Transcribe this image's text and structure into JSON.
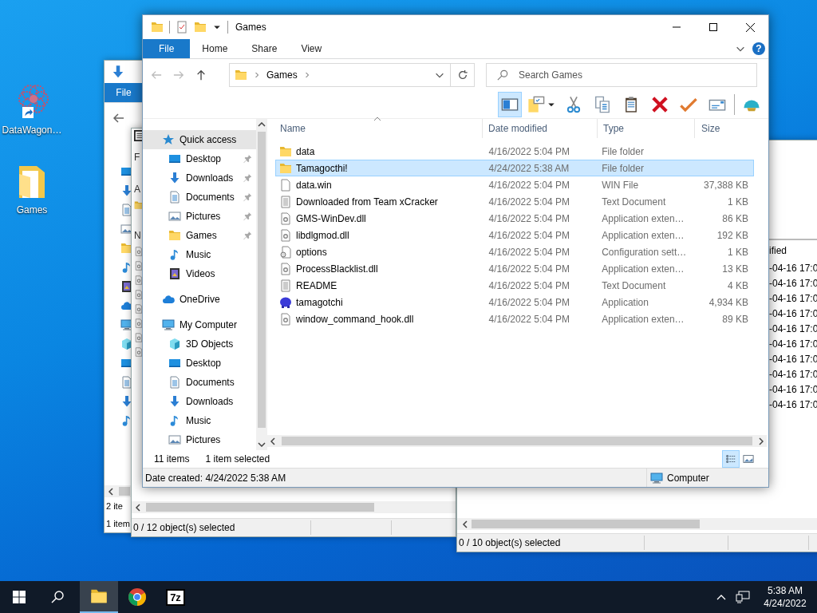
{
  "desktop_icons": [
    {
      "label": "DataWagon…",
      "kind": "app",
      "shortcut": true
    },
    {
      "label": "Games",
      "kind": "folder",
      "shortcut": false
    }
  ],
  "background_windows": [
    {
      "kind": "explorer",
      "ribbon_tab": "File",
      "nav_icons": [
        {
          "kind": "desktop"
        },
        {
          "kind": "download"
        },
        {
          "kind": "documents"
        },
        {
          "kind": "pictures"
        },
        {
          "kind": "folder"
        },
        {
          "kind": "music"
        },
        {
          "kind": "videos"
        },
        {
          "kind": "cloud"
        },
        {
          "kind": "computer"
        },
        {
          "kind": "cube"
        },
        {
          "kind": "desktop"
        },
        {
          "kind": "documents"
        },
        {
          "kind": "download"
        },
        {
          "kind": "music"
        }
      ],
      "status_lines": [
        "2 ite",
        "1 item"
      ]
    },
    {
      "kind": "archiver-left",
      "side_labels": [
        "F",
        "A",
        "N"
      ],
      "status": "0 / 12 object(s) selected"
    },
    {
      "kind": "archiver-right",
      "column_header": "ified",
      "cells": [
        "-04-16 17:0",
        "-04-16 17:0",
        "-04-16 17:0",
        "-04-16 17:0",
        "-04-16 17:0",
        "-04-16 17:0",
        "-04-16 17:0",
        "-04-16 17:0",
        "-04-16 17:0",
        "-04-16 17:0"
      ],
      "status": "0 / 10 object(s) selected"
    }
  ],
  "window": {
    "title": "Games",
    "ribbon_tabs": [
      {
        "label": "File",
        "selected": true
      },
      {
        "label": "Home",
        "selected": false
      },
      {
        "label": "Share",
        "selected": false
      },
      {
        "label": "View",
        "selected": false
      }
    ],
    "help_label": "?",
    "address": {
      "path": [
        "Games"
      ]
    },
    "search": {
      "placeholder": "Search Games"
    },
    "toolbar": [
      {
        "kind": "preview-pane",
        "selected": true
      },
      {
        "kind": "new-folder",
        "selected": false
      },
      {
        "kind": "cut",
        "selected": false
      },
      {
        "kind": "copy",
        "selected": false
      },
      {
        "kind": "paste",
        "selected": false
      },
      {
        "kind": "delete",
        "selected": false
      },
      {
        "kind": "check",
        "selected": false
      },
      {
        "kind": "envelope",
        "selected": false
      },
      {
        "kind": "shell",
        "selected": false
      }
    ],
    "navigation": [
      {
        "label": "Quick access",
        "kind": "star",
        "selected": true,
        "children": [
          {
            "label": "Desktop",
            "kind": "desktop",
            "pinned": true,
            "selected": false
          },
          {
            "label": "Downloads",
            "kind": "download",
            "pinned": true,
            "selected": false
          },
          {
            "label": "Documents",
            "kind": "documents",
            "pinned": true,
            "selected": false
          },
          {
            "label": "Pictures",
            "kind": "pictures",
            "pinned": true,
            "selected": false
          },
          {
            "label": "Games",
            "kind": "folder",
            "pinned": true,
            "selected": false
          },
          {
            "label": "Music",
            "kind": "music",
            "pinned": false,
            "selected": false
          },
          {
            "label": "Videos",
            "kind": "videos",
            "pinned": false,
            "selected": false
          }
        ]
      },
      {
        "label": "OneDrive",
        "kind": "cloud",
        "selected": false
      },
      {
        "label": "My Computer",
        "kind": "computer",
        "selected": false,
        "children": [
          {
            "label": "3D Objects",
            "kind": "cube",
            "pinned": false,
            "selected": false
          },
          {
            "label": "Desktop",
            "kind": "desktop",
            "pinned": false,
            "selected": false
          },
          {
            "label": "Documents",
            "kind": "documents",
            "pinned": false,
            "selected": false
          },
          {
            "label": "Downloads",
            "kind": "download",
            "pinned": false,
            "selected": false
          },
          {
            "label": "Music",
            "kind": "music",
            "pinned": false,
            "selected": false
          },
          {
            "label": "Pictures",
            "kind": "pictures",
            "pinned": false,
            "selected": false
          }
        ]
      }
    ],
    "columns": [
      {
        "label": "Name",
        "sorted": true
      },
      {
        "label": "Date modified",
        "sorted": false
      },
      {
        "label": "Type",
        "sorted": false
      },
      {
        "label": "Size",
        "sorted": false
      }
    ],
    "files": [
      {
        "name": "data",
        "date": "4/16/2022 5:04 PM",
        "type": "File folder",
        "kind": "folder",
        "selected": false
      },
      {
        "name": "Tamagocthi!",
        "date": "4/24/2022 5:38 AM",
        "type": "File folder",
        "kind": "folder",
        "selected": true
      },
      {
        "name": "data.win",
        "date": "4/16/2022 5:04 PM",
        "type": "WIN File",
        "size": "37,388 KB",
        "kind": "file",
        "selected": false
      },
      {
        "name": "Downloaded from Team xCracker",
        "date": "4/16/2022 5:04 PM",
        "type": "Text Document",
        "size": "1 KB",
        "kind": "text",
        "selected": false
      },
      {
        "name": "GMS-WinDev.dll",
        "date": "4/16/2022 5:04 PM",
        "type": "Application exten…",
        "size": "86 KB",
        "kind": "dll",
        "selected": false
      },
      {
        "name": "libdlgmod.dll",
        "date": "4/16/2022 5:04 PM",
        "type": "Application exten…",
        "size": "192 KB",
        "kind": "dll",
        "selected": false
      },
      {
        "name": "options",
        "date": "4/16/2022 5:04 PM",
        "type": "Configuration sett…",
        "size": "1 KB",
        "kind": "config",
        "selected": false
      },
      {
        "name": "ProcessBlacklist.dll",
        "date": "4/16/2022 5:04 PM",
        "type": "Application exten…",
        "size": "13 KB",
        "kind": "dll",
        "selected": false
      },
      {
        "name": "README",
        "date": "4/16/2022 5:04 PM",
        "type": "Text Document",
        "size": "4 KB",
        "kind": "text",
        "selected": false
      },
      {
        "name": "tamagotchi",
        "date": "4/16/2022 5:04 PM",
        "type": "Application",
        "size": "4,934 KB",
        "kind": "app",
        "selected": false
      },
      {
        "name": "window_command_hook.dll",
        "date": "4/16/2022 5:04 PM",
        "type": "Application exten…",
        "size": "89 KB",
        "kind": "dll",
        "selected": false
      }
    ],
    "status": {
      "item_count": "11 items",
      "selection": "1 item selected"
    },
    "view_buttons": [
      {
        "kind": "details",
        "selected": true
      },
      {
        "kind": "large-icons",
        "selected": false
      }
    ],
    "details_bar": {
      "text": "Date created: 4/24/2022 5:38 AM",
      "location": "Computer"
    }
  },
  "taskbar": {
    "apps": [
      {
        "kind": "explorer",
        "selected": true
      },
      {
        "kind": "browser",
        "selected": false
      },
      {
        "kind": "archiver",
        "label": "7z",
        "selected": false
      }
    ],
    "clock": {
      "time": "5:38 AM",
      "date": "4/24/2022"
    }
  }
}
